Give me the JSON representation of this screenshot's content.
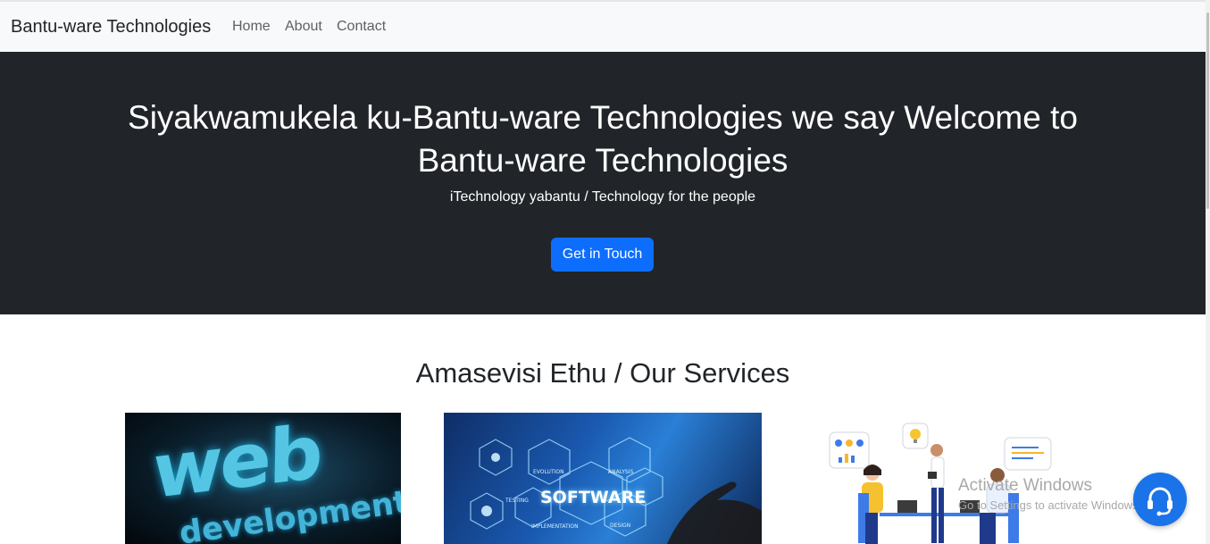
{
  "navbar": {
    "brand": "Bantu-ware Technologies",
    "links": [
      "Home",
      "About",
      "Contact"
    ]
  },
  "hero": {
    "title": "Siyakwamukela ku-Bantu-ware Technologies we say Welcome to Bantu-ware Technologies",
    "subtitle": "iTechnology yabantu / Technology for the people",
    "cta_label": "Get in Touch"
  },
  "services": {
    "title": "Amasevisi Ethu / Our Services",
    "image_words": {
      "web_top": "web",
      "web_bottom": "development",
      "software": "SOFTWARE",
      "hex_evolution": "EVOLUTION",
      "hex_testing": "TESTING",
      "hex_analysis": "ANALYSIS",
      "hex_implementation": "IMPLEMENTATION",
      "hex_design": "DESIGN"
    }
  },
  "system_overlay": {
    "activate_title": "Activate Windows",
    "activate_hint": "Go to Settings to activate Windows."
  },
  "colors": {
    "hero_bg": "#212529",
    "primary": "#0d6efd",
    "navbar_bg": "#f8f9fa",
    "chat_button": "#1a73e8"
  },
  "icons": {
    "chat_button": "headset-icon"
  }
}
